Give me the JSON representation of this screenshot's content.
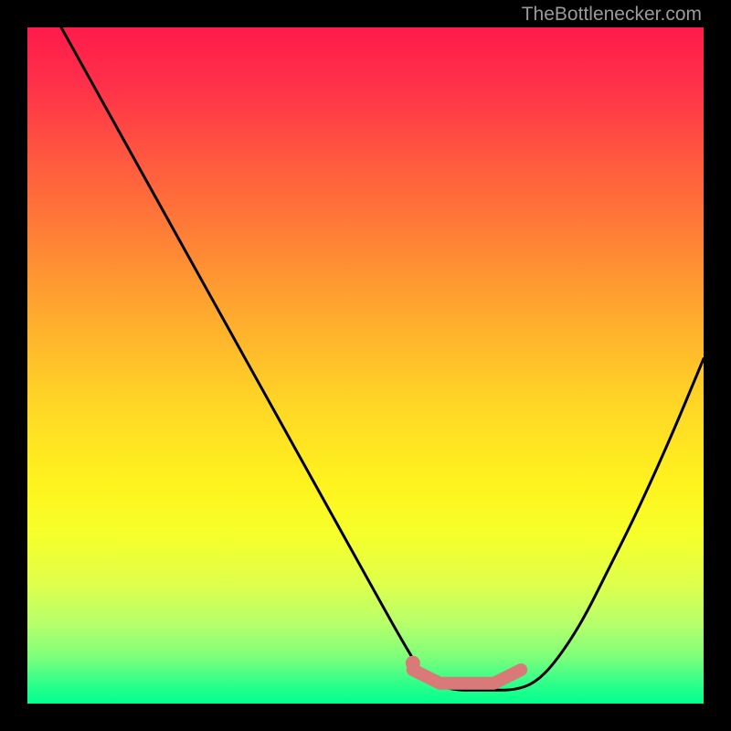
{
  "watermark": "TheBottleneсker.com",
  "chart_data": {
    "type": "line",
    "title": "",
    "xlabel": "",
    "ylabel": "",
    "xlim": [
      0,
      100
    ],
    "ylim": [
      0,
      100
    ],
    "series": [
      {
        "name": "bottleneck-curve",
        "x": [
          5,
          10,
          15,
          20,
          25,
          30,
          35,
          40,
          45,
          50,
          55,
          58,
          60,
          63,
          66,
          69,
          72,
          75,
          78,
          82,
          86,
          90,
          95,
          100
        ],
        "values": [
          100,
          91,
          82,
          73,
          64,
          55,
          46,
          37,
          28,
          19,
          10,
          5,
          3,
          2,
          2,
          2,
          2,
          3,
          6,
          12,
          20,
          28,
          39,
          51
        ]
      },
      {
        "name": "highlight-segment",
        "x": [
          57,
          59,
          61,
          63,
          65,
          67,
          69,
          71,
          73
        ],
        "values": [
          5,
          4,
          3,
          3,
          3,
          3,
          3,
          4,
          5
        ]
      }
    ],
    "highlight_point": {
      "x": 57,
      "y": 6
    },
    "colors": {
      "curve": "#000000",
      "highlight": "#d97a78",
      "highlight_point": "#d97a78",
      "gradient_top": "#ff1b4b",
      "gradient_bottom": "#00ff90"
    }
  }
}
